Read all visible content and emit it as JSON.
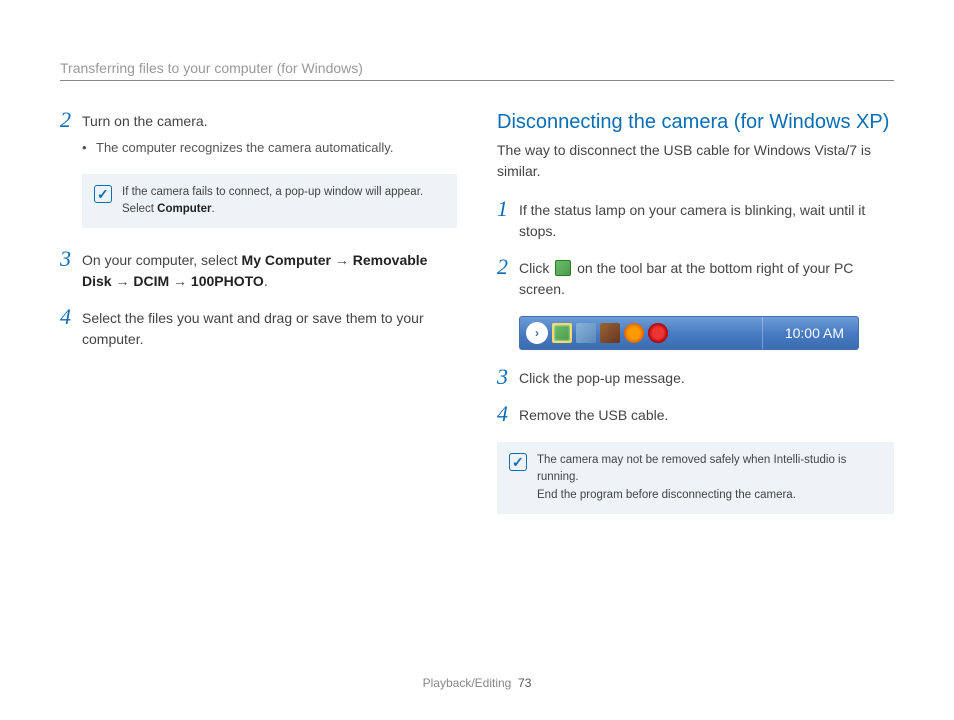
{
  "header": "Transferring files to your computer (for Windows)",
  "left": {
    "step2": {
      "num": "2",
      "text": "Turn on the camera.",
      "bullet": "The computer recognizes the camera automatically."
    },
    "note1": {
      "line1": "If the camera fails to connect, a pop-up window will appear.",
      "line2_a": "Select ",
      "line2_b": "Computer",
      "line2_c": "."
    },
    "step3": {
      "num": "3",
      "text_a": "On your computer, select ",
      "b1": "My Computer",
      "arrow": " → ",
      "b2": "Removable Disk",
      "b3": "DCIM",
      "b4": "100PHOTO",
      "period": "."
    },
    "step4": {
      "num": "4",
      "text": "Select the files you want and drag or save them to your computer."
    }
  },
  "right": {
    "title": "Disconnecting the camera (for Windows XP)",
    "sub": "The way to disconnect the USB cable for Windows Vista/7 is similar.",
    "step1": {
      "num": "1",
      "text": "If the status lamp on your camera is blinking, wait until it stops."
    },
    "step2": {
      "num": "2",
      "text_a": "Click ",
      "text_b": " on the tool bar at the bottom right of your PC screen."
    },
    "taskbar": {
      "time": "10:00 AM"
    },
    "step3": {
      "num": "3",
      "text": "Click the pop-up message."
    },
    "step4": {
      "num": "4",
      "text": "Remove the USB cable."
    },
    "note2": {
      "line1": "The camera may not be removed safely when Intelli-studio is running.",
      "line2": "End the program before disconnecting the camera."
    }
  },
  "footer": {
    "section": "Playback/Editing",
    "page": "73"
  }
}
